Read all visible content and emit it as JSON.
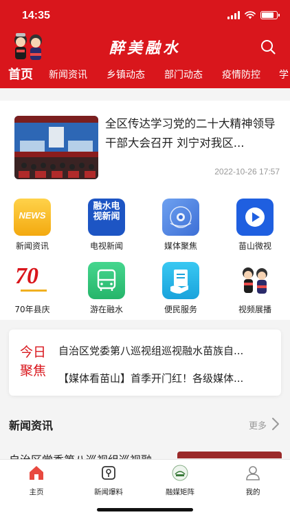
{
  "status_bar": {
    "time": "14:35"
  },
  "header": {
    "title": "醉美融水",
    "mascot_icon": "mascot-icon",
    "search_icon": "search-icon"
  },
  "nav_tabs": [
    {
      "label": "首页",
      "active": true
    },
    {
      "label": "新闻资讯",
      "active": false
    },
    {
      "label": "乡镇动态",
      "active": false
    },
    {
      "label": "部门动态",
      "active": false
    },
    {
      "label": "疫情防控",
      "active": false
    },
    {
      "label": "学",
      "active": false
    }
  ],
  "headline": {
    "title": "全区传达学习党的二十大精神领导干部大会召开 刘宁对我区...",
    "time": "2022-10-26 17:57"
  },
  "grid": [
    {
      "label": "新闻资讯",
      "icon": "news-icon",
      "icon_text": "NEWS",
      "color": "#f5b21b"
    },
    {
      "label": "电视新闻",
      "icon": "tv-news-icon",
      "icon_text": "融水电视新闻",
      "color": "#1d55c4"
    },
    {
      "label": "媒体聚焦",
      "icon": "media-focus-icon",
      "color": "#5c8ee6"
    },
    {
      "label": "苗山微视",
      "icon": "play-icon",
      "color": "#1f5fe0"
    },
    {
      "label": "70年县庆",
      "icon": "anniversary-70-icon",
      "icon_text": "70",
      "color": "#d9161c"
    },
    {
      "label": "游在融水",
      "icon": "bus-icon",
      "color": "#35c27a"
    },
    {
      "label": "便民服务",
      "icon": "service-icon",
      "color": "#26b6e6"
    },
    {
      "label": "视频展播",
      "icon": "mascot-video-icon",
      "color": "#d9161c"
    }
  ],
  "focus": {
    "tag": "今日聚焦",
    "items": [
      "自治区党委第八巡视组巡视融水苗族自...",
      "【媒体看苗山】首季开门红！各级媒体..."
    ]
  },
  "news_section": {
    "title": "新闻资讯",
    "more": "更多",
    "peek_title": "自治区党委第八巡视组巡视融"
  },
  "tabbar": [
    {
      "label": "主页",
      "icon": "home-icon",
      "active": true
    },
    {
      "label": "新闻爆料",
      "icon": "news-tip-icon",
      "active": false
    },
    {
      "label": "融媒矩阵",
      "icon": "media-matrix-icon",
      "active": false
    },
    {
      "label": "我的",
      "icon": "user-icon",
      "active": false
    }
  ],
  "colors": {
    "brand_red": "#d9161c",
    "text": "#222222",
    "muted": "#999999"
  }
}
